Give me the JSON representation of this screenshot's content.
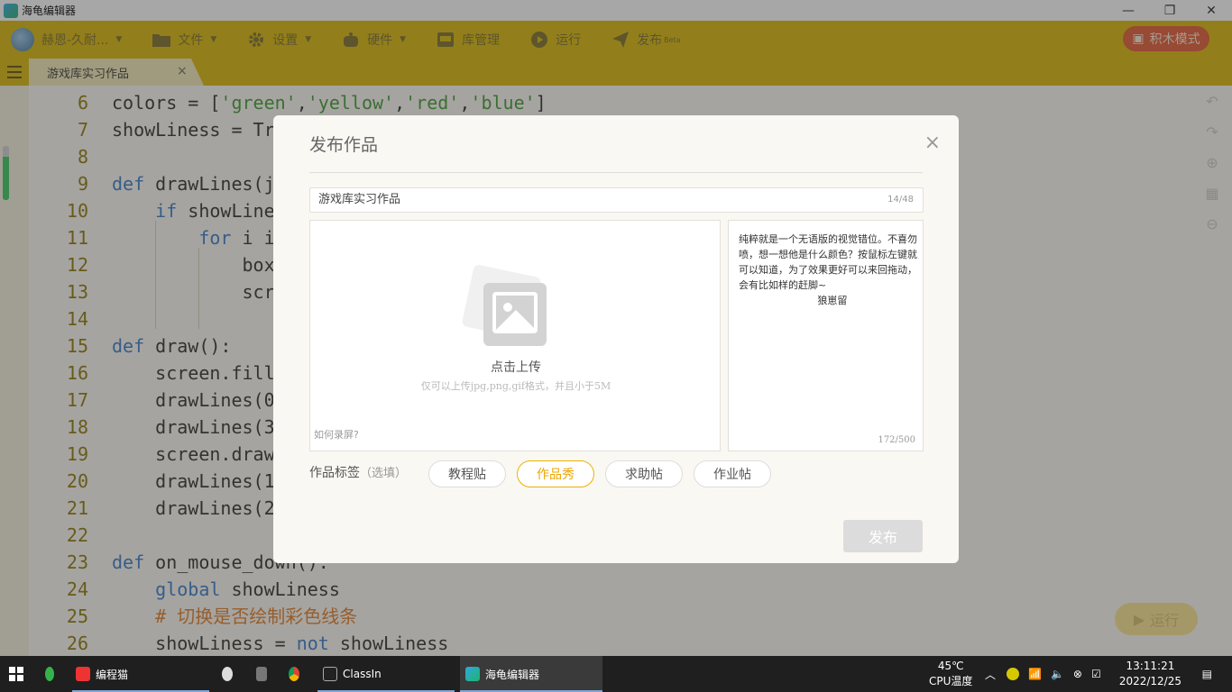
{
  "window": {
    "title": "海龟编辑器",
    "minimize": "—",
    "restore": "❐",
    "close": "✕"
  },
  "toolbar": {
    "user_name": "赫恩-久耐...",
    "file": "文件",
    "settings": "设置",
    "hardware": "硬件",
    "library": "库管理",
    "run": "运行",
    "publish": "发布",
    "publish_badge": "Beta",
    "block_mode": "积木模式"
  },
  "tab": {
    "label": "游戏库实习作品",
    "close": "×"
  },
  "code_lines": [
    {
      "n": "6",
      "code": "colors = ['green','yellow','red','blue']"
    },
    {
      "n": "7",
      "code": "showLiness = Tr"
    },
    {
      "n": "8",
      "code": ""
    },
    {
      "n": "9",
      "code": "def drawLines(j"
    },
    {
      "n": "10",
      "code": "    if showLine"
    },
    {
      "n": "11",
      "code": "        for i i"
    },
    {
      "n": "12",
      "code": "            box"
    },
    {
      "n": "13",
      "code": "            scr"
    },
    {
      "n": "14",
      "code": ""
    },
    {
      "n": "15",
      "code": "def draw():"
    },
    {
      "n": "16",
      "code": "    screen.fill"
    },
    {
      "n": "17",
      "code": "    drawLines(0"
    },
    {
      "n": "18",
      "code": "    drawLines(3"
    },
    {
      "n": "19",
      "code": "    screen.draw"
    },
    {
      "n": "20",
      "code": "    drawLines(1"
    },
    {
      "n": "21",
      "code": "    drawLines(2"
    },
    {
      "n": "22",
      "code": ""
    },
    {
      "n": "23",
      "code": "def on_mouse_down():"
    },
    {
      "n": "24",
      "code": "    global showLiness"
    },
    {
      "n": "25",
      "code": "    # 切换是否绘制彩色线条"
    },
    {
      "n": "26",
      "code": "    showLiness = not showLiness"
    }
  ],
  "editor": {
    "run_button": "运行"
  },
  "dialog": {
    "title": "发布作品",
    "close": "×",
    "title_value": "游戏库实习作品",
    "title_count": "14/48",
    "upload_label": "点击上传",
    "upload_hint": "仅可以上传jpg,png,gif格式，并且小于5M",
    "record_link": "如何录屏?",
    "description": "纯粹就是一个无语版的视觉错位。不喜勿喷，想一想他是什么颜色？按鼠标左键就可以知道，为了效果更好可以来回拖动，会有比如样的赶脚~\n                         狼崽留",
    "desc_count": "172/500",
    "tags_label": "作品标签",
    "tags_optional": "（选填）",
    "tags": [
      "教程贴",
      "作品秀",
      "求助帖",
      "作业帖"
    ],
    "selected_tag": "作品秀",
    "publish_button": "发布"
  },
  "taskbar": {
    "app1": "编程猫",
    "app2": "ClassIn",
    "app3": "海龟编辑器",
    "temp": "45℃",
    "temp_label": "CPU温度",
    "time": "13:11:21",
    "date": "2022/12/25"
  },
  "colors": {
    "toolbar_bg": "#d9b600",
    "accent": "#e9b300",
    "block_mode_bg": "#e2562f"
  }
}
